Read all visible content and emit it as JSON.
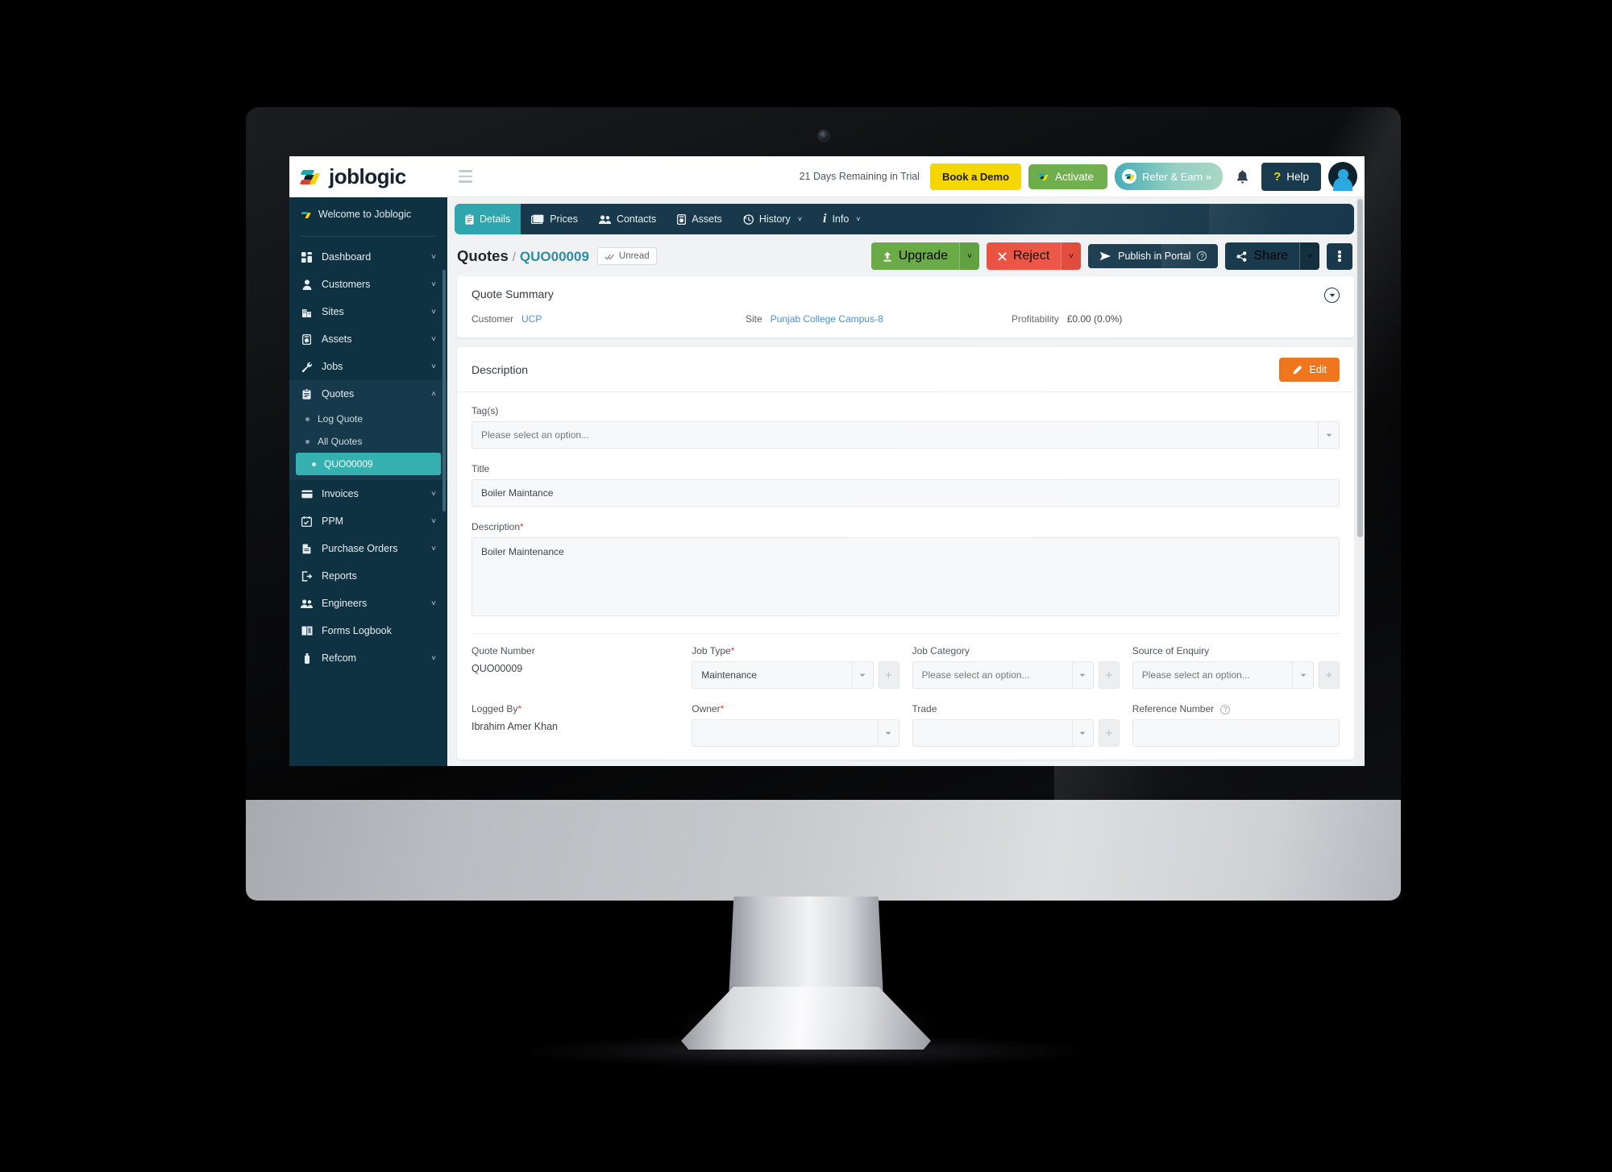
{
  "topbar": {
    "brand_name": "joblogic",
    "menu_icon": "hamburger-icon",
    "trial_text": "21 Days Remaining in Trial",
    "book_demo": "Book a Demo",
    "activate": "Activate",
    "refer_earn": "Refer & Earn  »",
    "help": "Help",
    "help_mark": "?"
  },
  "sidebar": {
    "welcome": "Welcome to Joblogic",
    "items": [
      {
        "label": "Dashboard",
        "icon": "grid-icon",
        "chevron": "˅",
        "expanded": false
      },
      {
        "label": "Customers",
        "icon": "person-icon",
        "chevron": "˅",
        "expanded": false
      },
      {
        "label": "Sites",
        "icon": "building-icon",
        "chevron": "˅",
        "expanded": false
      },
      {
        "label": "Assets",
        "icon": "asset-icon",
        "chevron": "˅",
        "expanded": false
      },
      {
        "label": "Jobs",
        "icon": "wrench-icon",
        "chevron": "˅",
        "expanded": false
      },
      {
        "label": "Quotes",
        "icon": "clipboard-icon",
        "chevron": "˄",
        "expanded": true
      },
      {
        "label": "Invoices",
        "icon": "card-icon",
        "chevron": "˅",
        "expanded": false
      },
      {
        "label": "PPM",
        "icon": "calendar-icon",
        "chevron": "˅",
        "expanded": false
      },
      {
        "label": "Purchase Orders",
        "icon": "document-icon",
        "chevron": "˅",
        "expanded": false
      },
      {
        "label": "Reports",
        "icon": "export-icon",
        "chevron": "",
        "expanded": false
      },
      {
        "label": "Engineers",
        "icon": "people-icon",
        "chevron": "˅",
        "expanded": false
      },
      {
        "label": "Forms Logbook",
        "icon": "book-icon",
        "chevron": "",
        "expanded": false
      },
      {
        "label": "Refcom",
        "icon": "bottle-icon",
        "chevron": "˅",
        "expanded": false
      }
    ],
    "quotes_sub": [
      {
        "label": "Log Quote",
        "active": false
      },
      {
        "label": "All Quotes",
        "active": false
      },
      {
        "label": "QUO00009",
        "active": true
      }
    ]
  },
  "tabs": [
    {
      "label": "Details",
      "icon": "clipboard-icon",
      "active": true,
      "caret": ""
    },
    {
      "label": "Prices",
      "icon": "money-icon",
      "active": false,
      "caret": ""
    },
    {
      "label": "Contacts",
      "icon": "people-icon",
      "active": false,
      "caret": ""
    },
    {
      "label": "Assets",
      "icon": "asset-icon",
      "active": false,
      "caret": ""
    },
    {
      "label": "History",
      "icon": "clock-icon",
      "active": false,
      "caret": "˅"
    },
    {
      "label": "Info",
      "icon": "info-icon",
      "active": false,
      "caret": "˅"
    }
  ],
  "page": {
    "crumb_root": "Quotes",
    "crumb_sep": "/",
    "crumb_id": "QUO00009",
    "unread_label": "Unread",
    "unread_icon": "double-check-icon"
  },
  "actions": {
    "upgrade": "Upgrade",
    "upgrade_caret": "˅",
    "reject": "Reject",
    "reject_caret": "˅",
    "publish": "Publish in Portal",
    "publish_help": "?",
    "share": "Share",
    "share_caret": "˅",
    "kebab": "more-options"
  },
  "summary": {
    "title": "Quote Summary",
    "customer_label": "Customer",
    "customer_value": "UCP",
    "site_label": "Site",
    "site_value": "Punjab College Campus-8",
    "profit_label": "Profitability",
    "profit_value": "£0.00 (0.0%)",
    "collapse_icon": "chevron-down-circle-icon"
  },
  "description_card": {
    "title": "Description",
    "edit_label": "Edit",
    "tags_label": "Tag(s)",
    "tags_placeholder": "Please select an option...",
    "title_label": "Title",
    "title_value": "Boiler Maintance",
    "desc_label": "Description",
    "desc_required": "*",
    "desc_value": "Boiler Maintenance",
    "fields": [
      {
        "label": "Quote Number",
        "required": "",
        "type": "readonly",
        "value": "QUO00009"
      },
      {
        "label": "Job Type",
        "required": "*",
        "type": "select",
        "value": "Maintenance",
        "has_plus": true
      },
      {
        "label": "Job Category",
        "required": "",
        "type": "select",
        "value": "Please select an option...",
        "placeholder": true,
        "has_plus": true
      },
      {
        "label": "Source of Enquiry",
        "required": "",
        "type": "select",
        "value": "Please select an option...",
        "placeholder": true,
        "has_plus": true
      }
    ],
    "fields_row2": [
      {
        "label": "Logged By",
        "required": "*",
        "type": "readonly",
        "value": "Ibrahim Amer Khan"
      },
      {
        "label": "Owner",
        "required": "*",
        "type": "select",
        "value": "",
        "has_plus": false
      },
      {
        "label": "Trade",
        "required": "",
        "type": "select",
        "value": "",
        "has_plus": true
      },
      {
        "label": "Reference Number",
        "required": "",
        "type": "input",
        "value": "",
        "help": "?"
      }
    ]
  },
  "colors": {
    "sidebar_bg": "#0f3243",
    "accent_teal": "#2fa6ae",
    "brand_dark": "#17394b",
    "green": "#6aab47",
    "red": "#ea4f3d",
    "orange": "#f0761e",
    "yellow": "#f5d700",
    "link_blue": "#4a8fd6",
    "active_sub": "#35b1b1"
  }
}
